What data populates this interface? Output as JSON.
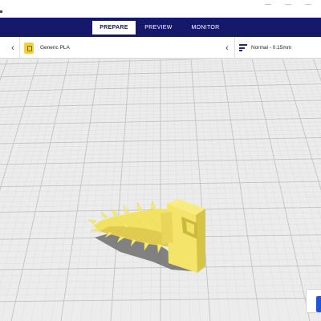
{
  "header": {
    "tabs": [
      {
        "label": "PREPARE",
        "active": true
      },
      {
        "label": "PREVIEW",
        "active": false
      },
      {
        "label": "MONITOR",
        "active": false
      }
    ]
  },
  "settings": {
    "material": "Generic PLA",
    "profile": "Normal - 0.15mm"
  },
  "icons": {
    "left_chevron": "chevron-left-icon",
    "mid_chevron": "chevron-left-icon",
    "material": "spool-icon",
    "profile": "print-settings-icon"
  },
  "colors": {
    "header": "#15196b",
    "model": "#f4e46a",
    "build_plate": "#ececec",
    "accent": "#1f55d9"
  }
}
